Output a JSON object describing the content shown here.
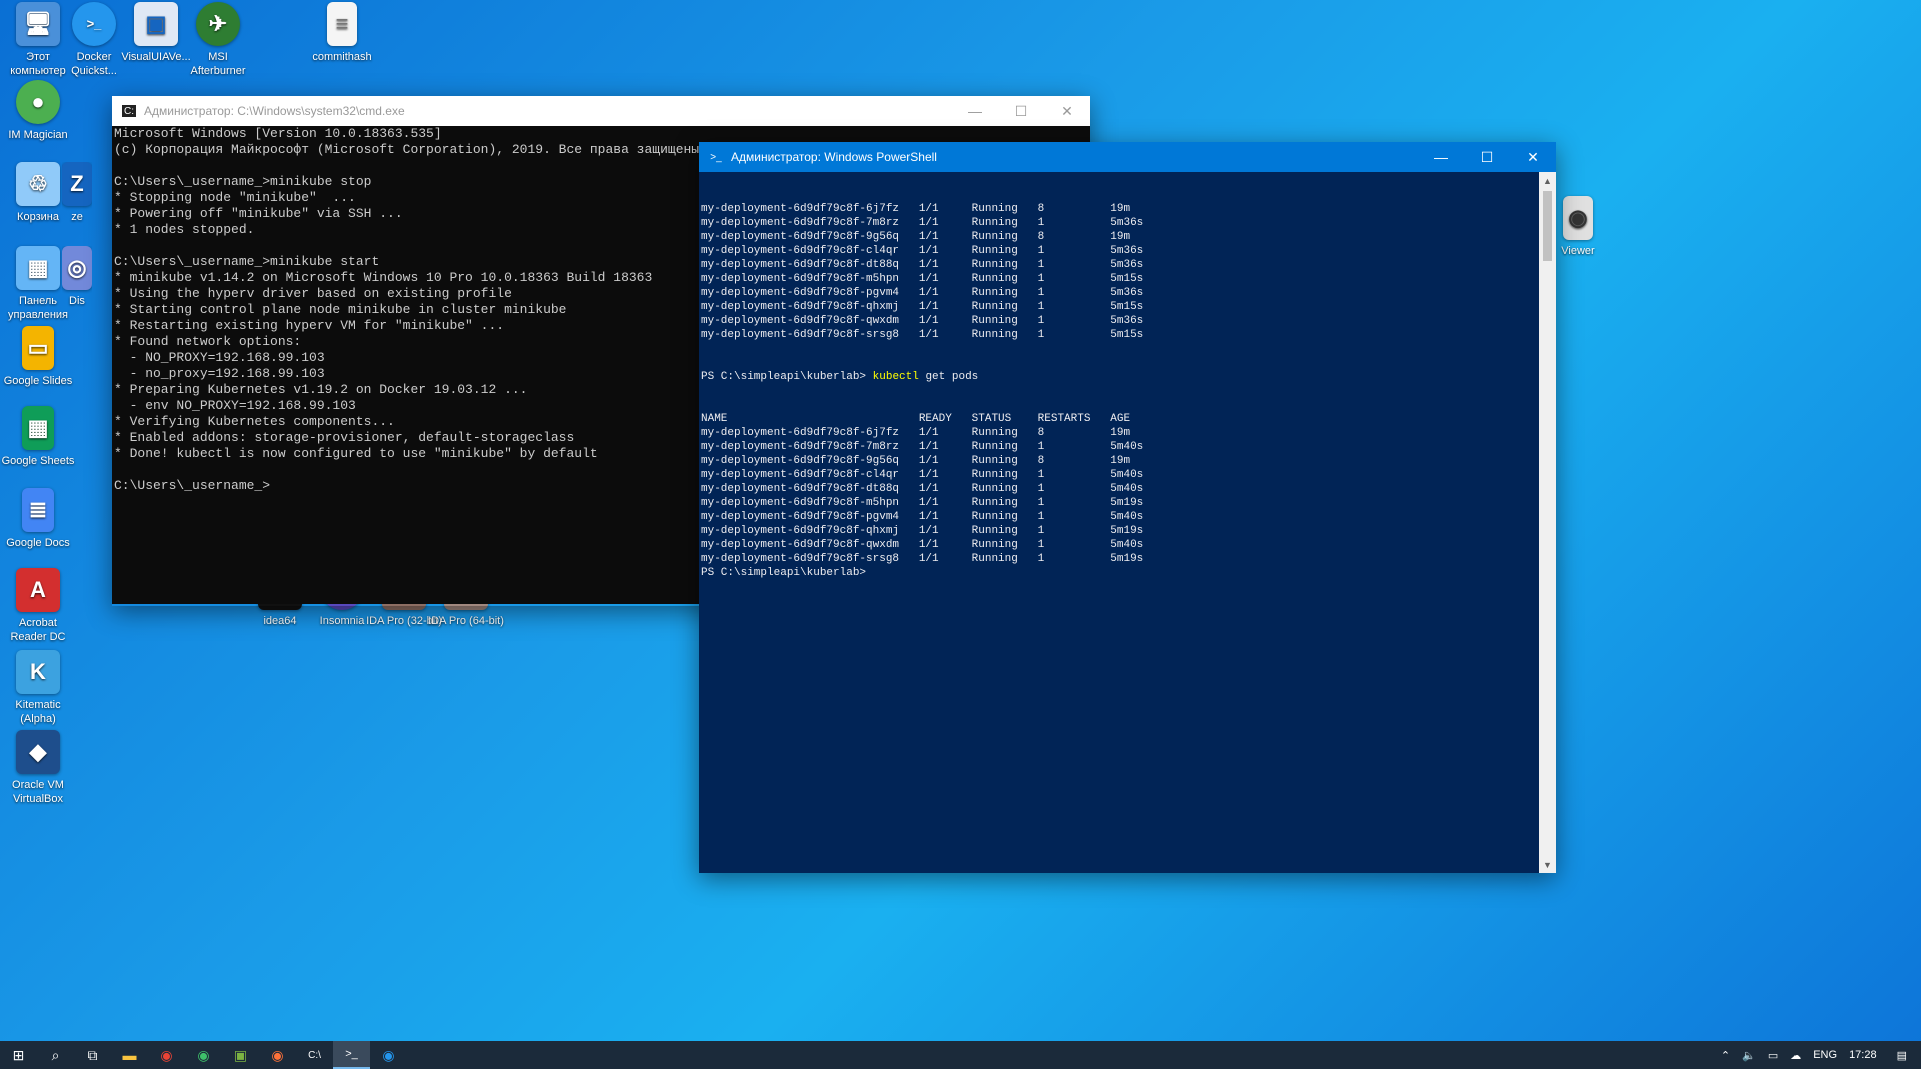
{
  "desktop": {
    "icons": [
      {
        "label": "Этот компьютер",
        "glyph": "🖥",
        "color": "#4a90d9"
      },
      {
        "label": "Docker Quickst...",
        "glyph": ">_",
        "color": "#2496ed"
      },
      {
        "label": "VisualUIAVe...",
        "glyph": "▣",
        "color": "#dfe8f5"
      },
      {
        "label": "MSI Afterburner",
        "glyph": "✈",
        "color": "#2e7d32"
      },
      {
        "label": "commithash",
        "glyph": "≡",
        "color": "#f5f5f5"
      },
      {
        "label": "IM Magician",
        "glyph": "●",
        "color": "#4caf50"
      },
      {
        "label": "Корзина",
        "glyph": "♲",
        "color": "#90caf9"
      },
      {
        "label": "Панель управления",
        "glyph": "▦",
        "color": "#64b5f6"
      },
      {
        "label": "Google Slides",
        "glyph": "▭",
        "color": "#f4b400"
      },
      {
        "label": "Google Sheets",
        "glyph": "▦",
        "color": "#0f9d58"
      },
      {
        "label": "Google Docs",
        "glyph": "≣",
        "color": "#4285f4"
      },
      {
        "label": "Acrobat Reader DC",
        "glyph": "A",
        "color": "#d32f2f"
      },
      {
        "label": "Kitematic (Alpha)",
        "glyph": "K",
        "color": "#3ca2e0"
      },
      {
        "label": "Oracle VM VirtualBox",
        "glyph": "◆",
        "color": "#1e4e8c"
      },
      {
        "label": "idea64",
        "glyph": "IJ",
        "color": "#111111"
      },
      {
        "label": "Insomnia",
        "glyph": "◐",
        "color": "#5849be"
      },
      {
        "label": "IDA Pro (32-bit)",
        "glyph": "☺",
        "color": "#8d6e63"
      },
      {
        "label": "IDA Pro (64-bit)",
        "glyph": "☺",
        "color": "#a1887f"
      },
      {
        "label": "Viewer",
        "glyph": "◉",
        "color": "#e0e0e0"
      },
      {
        "label": "ze",
        "glyph": "Z",
        "color": "#1565c0"
      },
      {
        "label": "Dis",
        "glyph": "◎",
        "color": "#7289da"
      }
    ]
  },
  "cmd": {
    "title": "Администратор: C:\\Windows\\system32\\cmd.exe",
    "lines": [
      "Microsoft Windows [Version 10.0.18363.535]",
      "(c) Корпорация Майкрософт (Microsoft Corporation), 2019. Все права защищены.",
      "",
      "C:\\Users\\_username_>minikube stop",
      "* Stopping node \"minikube\"  ...",
      "* Powering off \"minikube\" via SSH ...",
      "* 1 nodes stopped.",
      "",
      "C:\\Users\\_username_>minikube start",
      "* minikube v1.14.2 on Microsoft Windows 10 Pro 10.0.18363 Build 18363",
      "* Using the hyperv driver based on existing profile",
      "* Starting control plane node minikube in cluster minikube",
      "* Restarting existing hyperv VM for \"minikube\" ...",
      "* Found network options:",
      "  - NO_PROXY=192.168.99.103",
      "  - no_proxy=192.168.99.103",
      "* Preparing Kubernetes v1.19.2 on Docker 19.03.12 ...",
      "  - env NO_PROXY=192.168.99.103",
      "* Verifying Kubernetes components...",
      "* Enabled addons: storage-provisioner, default-storageclass",
      "* Done! kubectl is now configured to use \"minikube\" by default",
      "",
      "C:\\Users\\_username_>"
    ]
  },
  "powershell": {
    "title": "Администратор: Windows PowerShell",
    "lines_before": [
      "my-deployment-6d9df79c8f-6j7fz   1/1     Running   8          19m",
      "my-deployment-6d9df79c8f-7m8rz   1/1     Running   1          5m36s",
      "my-deployment-6d9df79c8f-9g56q   1/1     Running   8          19m",
      "my-deployment-6d9df79c8f-cl4qr   1/1     Running   1          5m36s",
      "my-deployment-6d9df79c8f-dt88q   1/1     Running   1          5m36s",
      "my-deployment-6d9df79c8f-m5hpn   1/1     Running   1          5m15s",
      "my-deployment-6d9df79c8f-pgvm4   1/1     Running   1          5m36s",
      "my-deployment-6d9df79c8f-qhxmj   1/1     Running   1          5m15s",
      "my-deployment-6d9df79c8f-qwxdm   1/1     Running   1          5m36s",
      "my-deployment-6d9df79c8f-srsg8   1/1     Running   1          5m15s"
    ],
    "prompt": "PS C:\\simpleapi\\kuberlab> ",
    "command": "kubectl",
    "command_args": " get pods",
    "lines_after": [
      "NAME                             READY   STATUS    RESTARTS   AGE",
      "my-deployment-6d9df79c8f-6j7fz   1/1     Running   8          19m",
      "my-deployment-6d9df79c8f-7m8rz   1/1     Running   1          5m40s",
      "my-deployment-6d9df79c8f-9g56q   1/1     Running   8          19m",
      "my-deployment-6d9df79c8f-cl4qr   1/1     Running   1          5m40s",
      "my-deployment-6d9df79c8f-dt88q   1/1     Running   1          5m40s",
      "my-deployment-6d9df79c8f-m5hpn   1/1     Running   1          5m19s",
      "my-deployment-6d9df79c8f-pgvm4   1/1     Running   1          5m40s",
      "my-deployment-6d9df79c8f-qhxmj   1/1     Running   1          5m19s",
      "my-deployment-6d9df79c8f-qwxdm   1/1     Running   1          5m40s",
      "my-deployment-6d9df79c8f-srsg8   1/1     Running   1          5m19s",
      "PS C:\\simpleapi\\kuberlab>"
    ]
  },
  "taskbar": {
    "lang": "ENG",
    "time": "17:28",
    "apps": [
      "chrome",
      "edge-chromium",
      "minecraft",
      "firefox",
      "cmd",
      "powershell",
      "docker"
    ]
  }
}
